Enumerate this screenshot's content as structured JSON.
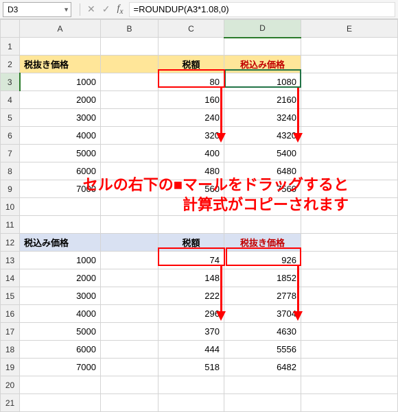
{
  "name_box": "D3",
  "formula": "=ROUNDUP(A3*1.08,0)",
  "columns": [
    "A",
    "B",
    "C",
    "D",
    "E"
  ],
  "selected_col": "D",
  "selected_row": 3,
  "table1": {
    "header": {
      "a": "税抜き価格",
      "c": "税額",
      "d": "税込み価格"
    },
    "rows": [
      {
        "a": "1000",
        "c": "80",
        "d": "1080"
      },
      {
        "a": "2000",
        "c": "160",
        "d": "2160"
      },
      {
        "a": "3000",
        "c": "240",
        "d": "3240"
      },
      {
        "a": "4000",
        "c": "320",
        "d": "4320"
      },
      {
        "a": "5000",
        "c": "400",
        "d": "5400"
      },
      {
        "a": "6000",
        "c": "480",
        "d": "6480"
      },
      {
        "a": "7000",
        "c": "560",
        "d": "7560"
      }
    ]
  },
  "table2": {
    "header": {
      "a": "税込み価格",
      "c": "税額",
      "d": "税抜き価格"
    },
    "rows": [
      {
        "a": "1000",
        "c": "74",
        "d": "926"
      },
      {
        "a": "2000",
        "c": "148",
        "d": "1852"
      },
      {
        "a": "3000",
        "c": "222",
        "d": "2778"
      },
      {
        "a": "4000",
        "c": "296",
        "d": "3704"
      },
      {
        "a": "5000",
        "c": "370",
        "d": "4630"
      },
      {
        "a": "6000",
        "c": "444",
        "d": "5556"
      },
      {
        "a": "7000",
        "c": "518",
        "d": "6482"
      }
    ]
  },
  "annotation_line1": "セルの右下の■マールをドラッグすると",
  "annotation_line2": "計算式がコピーされます"
}
